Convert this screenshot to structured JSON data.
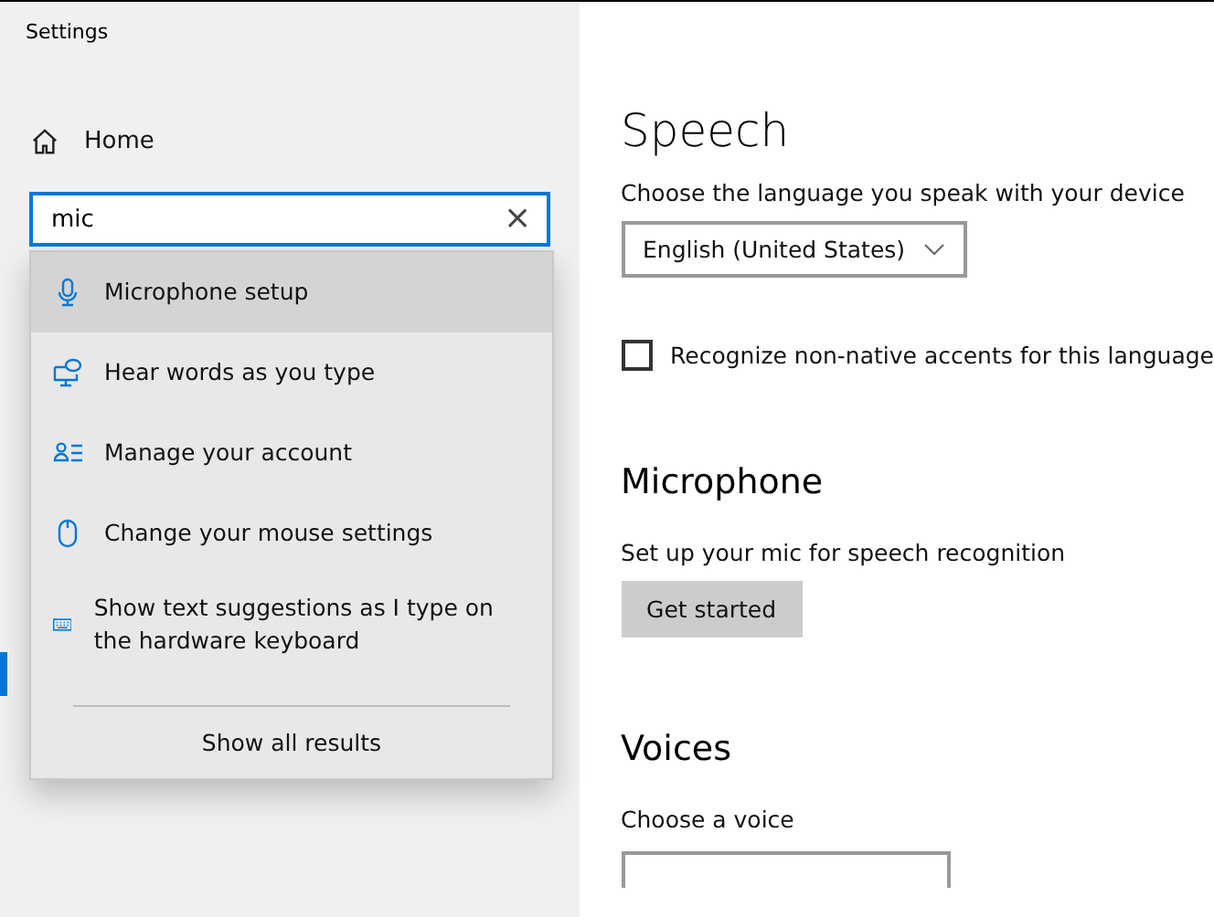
{
  "window": {
    "title": "Settings"
  },
  "sidebar": {
    "home": {
      "label": "Home"
    },
    "search": {
      "value": "mic",
      "clear": "×"
    },
    "selected_indicator": true
  },
  "suggestions": {
    "items": [
      {
        "kind": "microphone",
        "label": "Microphone setup",
        "selected": true
      },
      {
        "kind": "speech",
        "label": "Hear words as you type",
        "selected": false
      },
      {
        "kind": "account",
        "label": "Manage your account",
        "selected": false
      },
      {
        "kind": "mouse",
        "label": "Change your mouse settings",
        "selected": false
      },
      {
        "kind": "keyboard",
        "label": "Show text suggestions as I type on the hardware keyboard",
        "selected": false
      }
    ],
    "show_all": "Show all results"
  },
  "content": {
    "title": "Speech",
    "language": {
      "label": "Choose the language you speak with your device",
      "value": "English (United States)"
    },
    "accents": {
      "label": "Recognize non-native accents for this language",
      "checked": false
    },
    "microphone": {
      "heading": "Microphone",
      "text": "Set up your mic for speech recognition",
      "button": "Get started"
    },
    "voices": {
      "heading": "Voices",
      "label": "Choose a voice"
    }
  }
}
